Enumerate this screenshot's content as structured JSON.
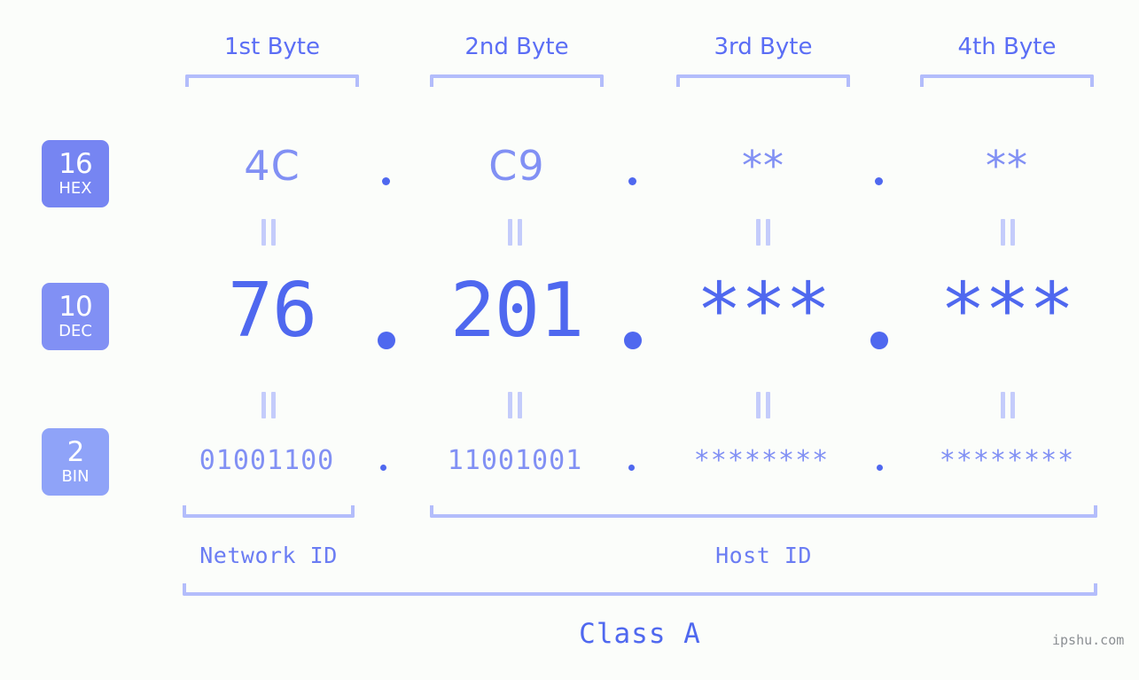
{
  "page": {
    "background_color": "#fbfdfa",
    "accent_color": "#4f68ef",
    "accent_light_color": "#8190f4",
    "bracket_color": "#b3bdfb",
    "watermark": "ipshu.com"
  },
  "byte_headers": [
    {
      "label": "1st Byte"
    },
    {
      "label": "2nd Byte"
    },
    {
      "label": "3rd Byte"
    },
    {
      "label": "4th Byte"
    }
  ],
  "rows": [
    {
      "badge": {
        "number": "16",
        "name": "HEX",
        "color": "#7685f2"
      },
      "values": [
        "4C",
        "C9",
        "**",
        "**"
      ],
      "separator": "."
    },
    {
      "badge": {
        "number": "10",
        "name": "DEC",
        "color": "#8190f4"
      },
      "values": [
        "76",
        "201",
        "***",
        "***"
      ],
      "separator": "."
    },
    {
      "badge": {
        "number": "2",
        "name": "BIN",
        "color": "#8fa3f8"
      },
      "values": [
        "01001100",
        "11001001",
        "********",
        "********"
      ],
      "separator": "."
    }
  ],
  "equals_marks": {
    "glyph": "=",
    "count_per_gap": 4
  },
  "sections": [
    {
      "label": "Network ID"
    },
    {
      "label": "Host ID"
    }
  ],
  "class": {
    "label": "Class A"
  }
}
